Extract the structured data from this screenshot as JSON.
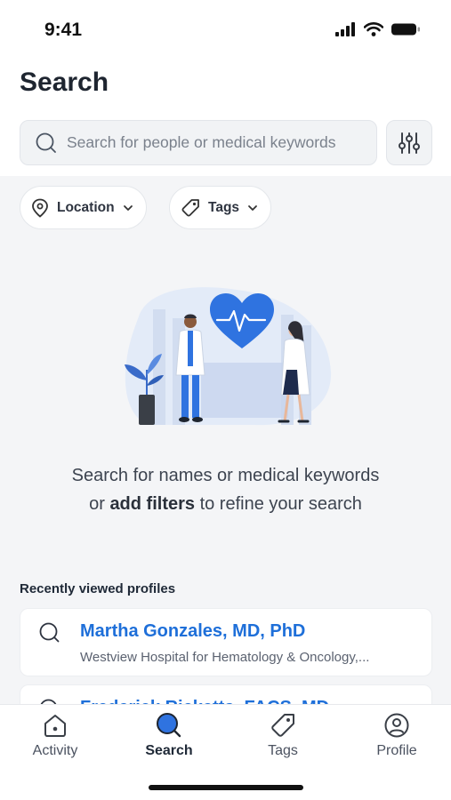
{
  "status_bar": {
    "time": "9:41"
  },
  "header": {
    "title": "Search",
    "search_placeholder": "Search for people or medical keywords"
  },
  "filters": [
    {
      "label": "Location",
      "icon": "location-pin-icon"
    },
    {
      "label": "Tags",
      "icon": "tag-icon"
    }
  ],
  "empty_state": {
    "line1": "Search for names or medical keywords",
    "line2_prefix": "or ",
    "line2_bold": "add filters",
    "line2_suffix": " to refine your search"
  },
  "recent": {
    "title": "Recently viewed profiles",
    "items": [
      {
        "name": "Martha Gonzales, MD, PhD",
        "subtitle": "Westview Hospital for Hematology & Oncology,..."
      },
      {
        "name": "Frederick Ricketts, FACS, MD",
        "subtitle": ""
      }
    ]
  },
  "tabs": [
    {
      "label": "Activity",
      "icon": "home-icon"
    },
    {
      "label": "Search",
      "icon": "search-icon",
      "active": true
    },
    {
      "label": "Tags",
      "icon": "tag-icon"
    },
    {
      "label": "Profile",
      "icon": "user-icon"
    }
  ],
  "colors": {
    "accent": "#1E6FD9",
    "heart": "#2F73E0",
    "background": "#F4F5F7"
  }
}
